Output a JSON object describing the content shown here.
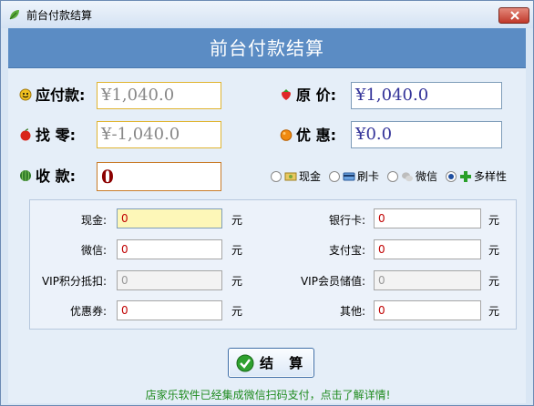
{
  "window": {
    "title": "前台付款结算",
    "header_title": "前台付款结算"
  },
  "summary": {
    "payable_label": "应付款:",
    "payable_value": "¥1,040.0",
    "original_price_label": "原  价:",
    "original_price_value": "¥1,040.0",
    "change_label": "找    零:",
    "change_value": "¥-1,040.0",
    "discount_label": "优  惠:",
    "discount_value": "¥0.0",
    "received_label": "收    款:",
    "received_value": "0"
  },
  "payment_methods": {
    "options": [
      "现金",
      "刷卡",
      "微信",
      "多样性"
    ],
    "selected": "多样性"
  },
  "fields": {
    "cash_label": "现金:",
    "cash_value": "0",
    "bankcard_label": "银行卡:",
    "bankcard_value": "0",
    "wechat_label": "微信:",
    "wechat_value": "0",
    "alipay_label": "支付宝:",
    "alipay_value": "0",
    "vip_points_label": "VIP积分抵扣:",
    "vip_points_value": "0",
    "vip_stored_label": "VIP会员储值:",
    "vip_stored_value": "0",
    "coupon_label": "优惠券:",
    "coupon_value": "0",
    "other_label": "其他:",
    "other_value": "0",
    "unit": "元"
  },
  "actions": {
    "settle_label": "结 算"
  },
  "footer": {
    "promo_text": "店家乐软件已经集成微信扫码支付，点击了解详情!"
  },
  "icons": {
    "title_icon": "leaf-icon",
    "close": "close-icon",
    "settle": "check-circle-icon"
  },
  "colors": {
    "header_bg": "#5b8cc4",
    "window_bg": "#d9e6f4",
    "close_btn": "#c0392b",
    "field_value": "#c00000",
    "promo": "#1e8b1e"
  }
}
